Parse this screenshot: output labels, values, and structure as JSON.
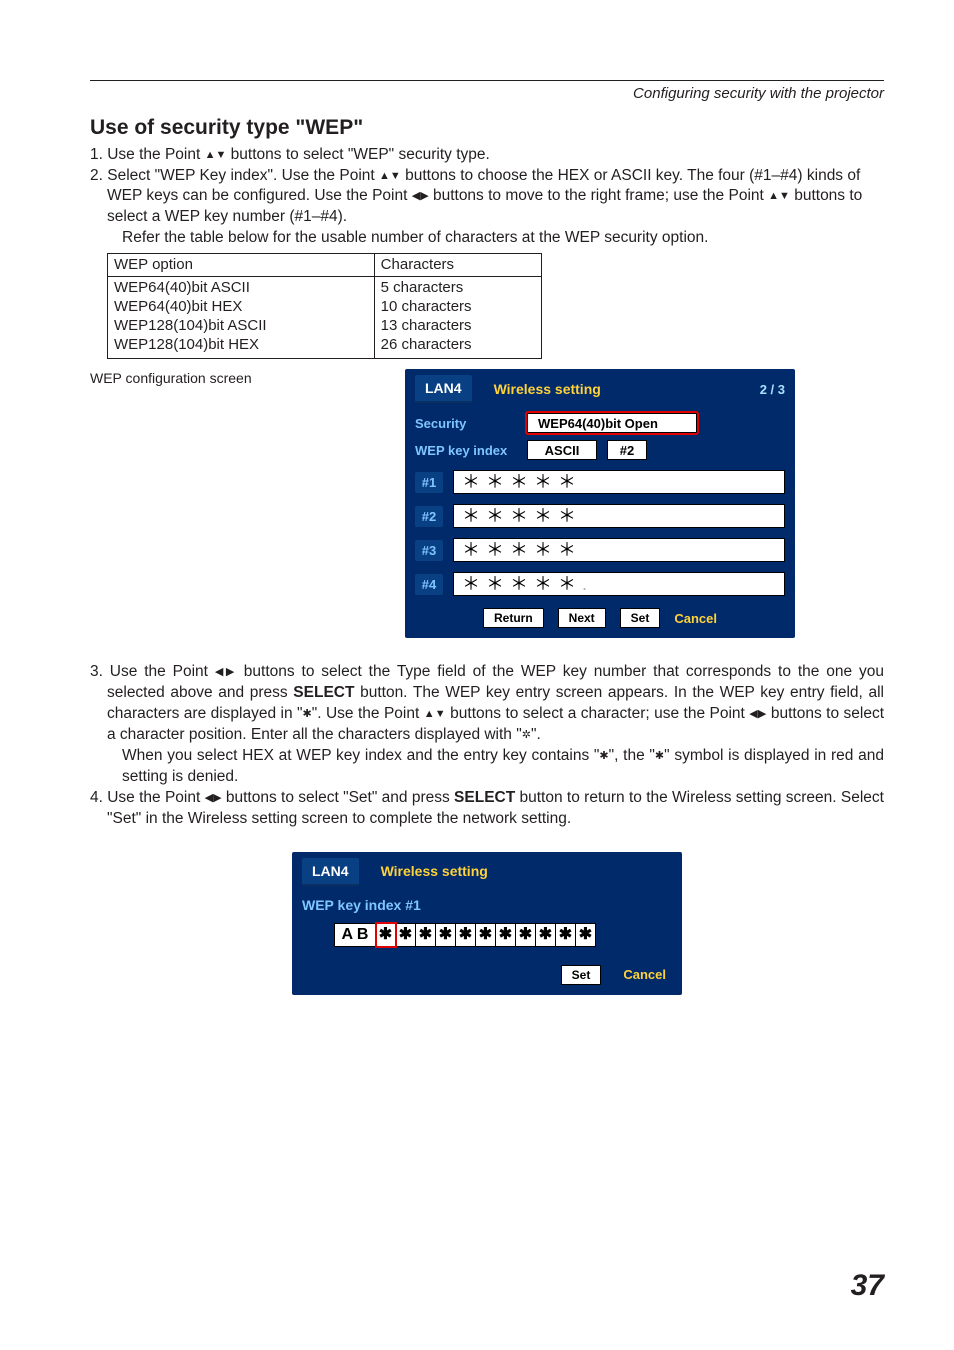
{
  "running_head": "Configuring security with the projector",
  "section_title": "Use of security type \"WEP\"",
  "step1_a": "1. Use the Point ",
  "step1_b": " buttons to select \"WEP\" security type.",
  "step2_a": "2. Select \"WEP Key index\". Use the Point ",
  "step2_b": " buttons to choose the HEX or ASCII key. The four (#1–#4) kinds of WEP keys can be configured. Use the Point ",
  "step2_c": " buttons to move to the right frame; use the Point ",
  "step2_d": " buttons to select a WEP key number (#1–#4).",
  "step2_note": "Refer the table below for the usable number of characters at the WEP security option.",
  "table": {
    "head_opt": "WEP option",
    "head_chars": "Characters",
    "rows": [
      {
        "opt": "WEP64(40)bit ASCII",
        "chars": "5 characters"
      },
      {
        "opt": "WEP64(40)bit HEX",
        "chars": "10 characters"
      },
      {
        "opt": "WEP128(104)bit ASCII",
        "chars": "13 characters"
      },
      {
        "opt": "WEP128(104)bit HEX",
        "chars": "26 characters"
      }
    ]
  },
  "fig1_caption": "WEP configuration screen",
  "osd1": {
    "tab": "LAN4",
    "title": "Wireless setting",
    "page": "2 / 3",
    "security_label": "Security",
    "security_value": "WEP64(40)bit Open",
    "wepidx_label": "WEP key index",
    "wepidx_mode": "ASCII",
    "wepidx_num": "#2",
    "keys": [
      {
        "badge": "#1",
        "value": "＊＊＊＊＊"
      },
      {
        "badge": "#2",
        "value": "＊＊＊＊＊"
      },
      {
        "badge": "#3",
        "value": "＊＊＊＊＊"
      },
      {
        "badge": "#4",
        "value": "＊＊＊＊＊"
      }
    ],
    "btn_return": "Return",
    "btn_next": "Next",
    "btn_set": "Set",
    "cancel": "Cancel"
  },
  "step3_a": "3. Use the Point ",
  "step3_b": " buttons to select the Type field of the WEP key number that corresponds to the one you selected above and press ",
  "step3_c": " button. The WEP key entry screen appears. In the WEP key entry field, all characters are displayed in \"",
  "step3_d": "\". Use the Point ",
  "step3_e": " buttons to select a character; use the Point ",
  "step3_f": " buttons to select a character position. Enter all the characters displayed with \"",
  "step3_g": "\".",
  "step3_note_a": "When you select HEX at WEP key index and the entry key contains \"",
  "step3_note_b": "\", the \"",
  "step3_note_c": "\" symbol is displayed in red and setting is denied.",
  "select_word": "SELECT",
  "step4_a": "4. Use the Point ",
  "step4_b": " buttons to select \"Set\" and press ",
  "step4_c": " button to return to the Wireless setting screen. Select \"Set\" in the Wireless setting screen to complete the network setting.",
  "osd2": {
    "tab": "LAN4",
    "title": "Wireless setting",
    "index_label": "WEP key index #1",
    "prefix": "A B",
    "cells": [
      "✱",
      "✱",
      "✱",
      "✱",
      "✱",
      "✱",
      "✱",
      "✱",
      "✱",
      "✱",
      "✱"
    ],
    "btn_set": "Set",
    "cancel": "Cancel"
  },
  "page_number": "37"
}
